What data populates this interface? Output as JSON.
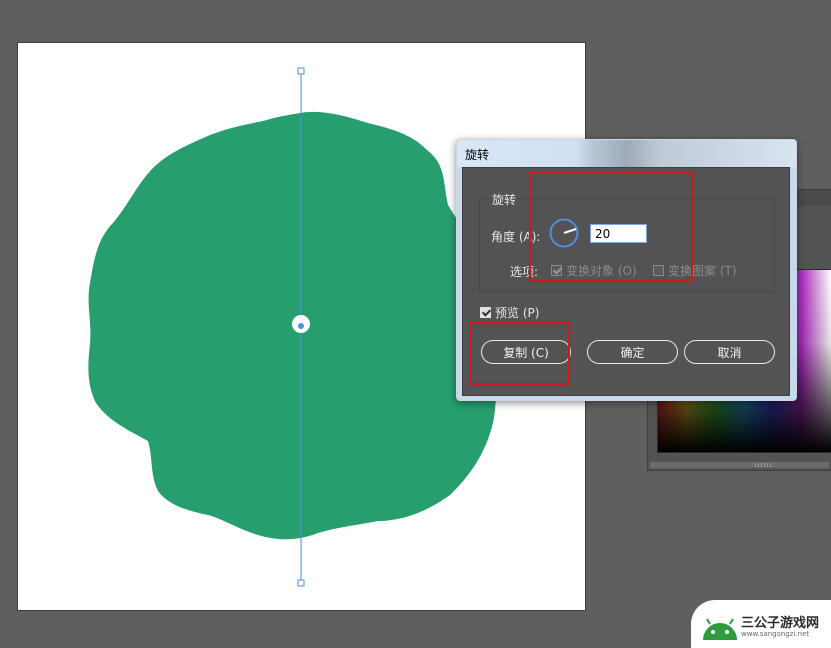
{
  "dialog": {
    "title": "旋转",
    "group_title": "旋转",
    "angle_label": "角度 (A):",
    "angle_value": "20",
    "options_label": "选项:",
    "transform_objects": {
      "label": "变换对象 (O)",
      "checked": true,
      "enabled": false
    },
    "transform_patterns": {
      "label": "变换图案 (T)",
      "checked": false,
      "enabled": false
    },
    "preview": {
      "label": "预览 (P)",
      "checked": true
    },
    "buttons": {
      "copy": "复制 (C)",
      "ok": "确定",
      "cancel": "取消"
    }
  },
  "canvas": {
    "shape_color": "#269e6d",
    "guide_color": "#4a8fe0"
  },
  "watermark": {
    "name": "三公子游戏网",
    "url": "www.sangongzi.net"
  }
}
